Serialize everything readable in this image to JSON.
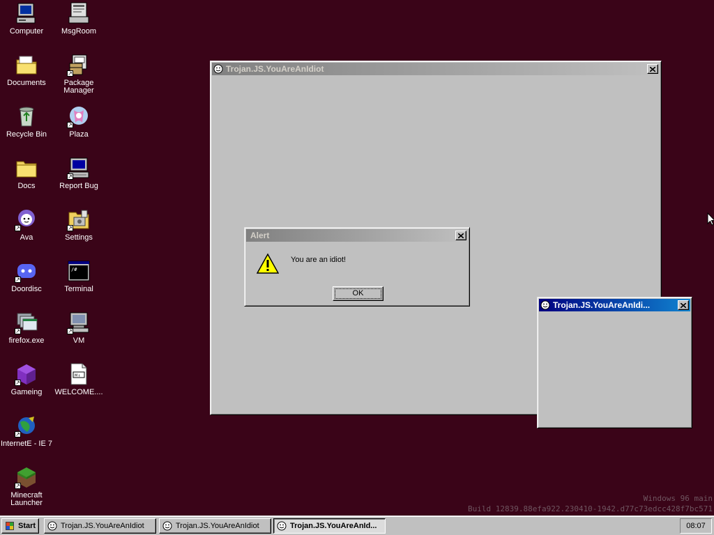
{
  "desktop": {
    "icons": [
      {
        "label": "Computer",
        "icon": "computer-icon"
      },
      {
        "label": "MsgRoom",
        "icon": "msgroom-icon"
      },
      {
        "label": "Documents",
        "icon": "documents-folder-icon"
      },
      {
        "label": "Package Manager",
        "icon": "package-manager-icon"
      },
      {
        "label": "Recycle Bin",
        "icon": "recycle-bin-icon"
      },
      {
        "label": "Plaza",
        "icon": "plaza-icon"
      },
      {
        "label": "Docs",
        "icon": "docs-folder-icon"
      },
      {
        "label": "Report Bug",
        "icon": "report-bug-icon"
      },
      {
        "label": "Ava",
        "icon": "ava-icon"
      },
      {
        "label": "Settings",
        "icon": "settings-icon"
      },
      {
        "label": "Doordisc",
        "icon": "doordisc-icon"
      },
      {
        "label": "Terminal",
        "icon": "terminal-icon"
      },
      {
        "label": "firefox.exe",
        "icon": "firefox-icon"
      },
      {
        "label": "VM",
        "icon": "vm-icon"
      },
      {
        "label": "Gameing",
        "icon": "gameing-icon"
      },
      {
        "label": "WELCOME....",
        "icon": "markdown-file-icon"
      },
      {
        "label": "InternetE - IE 7",
        "icon": "internet-explorer-icon"
      },
      {
        "label": "Minecraft Launcher",
        "icon": "minecraft-icon"
      }
    ]
  },
  "windows": [
    {
      "title": "Trojan.JS.YouAreAnIdiot",
      "active": false
    },
    {
      "title": "Trojan.JS.YouAreAnIdi...",
      "active": true
    }
  ],
  "alert": {
    "title": "Alert",
    "message": "You are an idiot!",
    "ok_label": "OK"
  },
  "watermark": {
    "line1": "Windows 96 main",
    "line2": "Build 12839.88efa922.230410-1942.d77c73edcc428f7bc571"
  },
  "taskbar": {
    "start_label": "Start",
    "tasks": [
      {
        "label": "Trojan.JS.YouAreAnIdiot",
        "active": false
      },
      {
        "label": "Trojan.JS.YouAreAnIdiot",
        "active": false
      },
      {
        "label": "Trojan.JS.YouAreAnId...",
        "active": true
      }
    ],
    "clock": "08:07"
  },
  "colors": {
    "desktop": "#3a0418",
    "titlebar_active": "#000080",
    "titlebar_inactive": "#808080",
    "face": "#c0c0c0"
  }
}
